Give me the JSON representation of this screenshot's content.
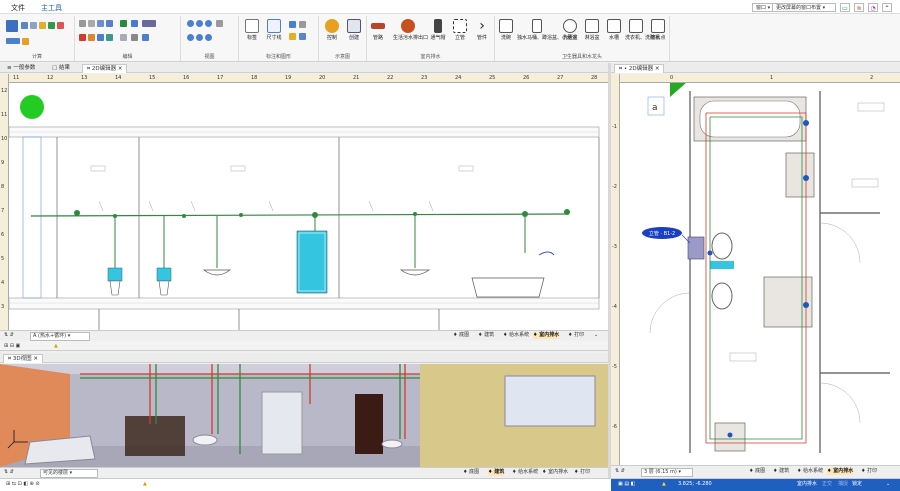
{
  "menu": {
    "file": "文件",
    "main_tools": "主工具"
  },
  "window_tools": {
    "window": "窗口 ▾",
    "layout": "更改屏幕的窗口布置 ▾"
  },
  "ribbon": {
    "groups": [
      "计算",
      "编辑",
      "视图",
      "标注和图形",
      "示意图",
      "室内排水",
      "卫生器具和水龙头"
    ],
    "items": {
      "mark": "标签",
      "dim": "尺寸线",
      "control": "控制",
      "create": "创建",
      "pipe": "管路",
      "outlet": "生活污水排出口",
      "vent_cap": "通气帽",
      "riser": "立管",
      "fitting": "管件",
      "sink": "洗碗",
      "urinal": "独水马桶、蹲浴盆、小便池",
      "washbasin": "洗脸盆",
      "shower_tray": "淋浴盆",
      "water_tank": "水槽",
      "washing_machine": "洗衣机、洗碗机",
      "floor_drain": "放水点"
    }
  },
  "left_tabs": [
    "一般参数",
    "结果",
    "2D编辑器"
  ],
  "right_tabs": [
    "2D编辑器"
  ],
  "view3d_tab": "3D视图",
  "ruler_top_left": [
    "11",
    "12",
    "13",
    "14",
    "15",
    "16",
    "17",
    "18",
    "19",
    "20",
    "21",
    "22",
    "23",
    "24",
    "25",
    "26",
    "27",
    "28"
  ],
  "ruler_left_left": [
    "12",
    "11",
    "10",
    "9",
    "8",
    "7",
    "6",
    "5",
    "4",
    "3"
  ],
  "ruler_top_right": [
    "0",
    "1",
    "2"
  ],
  "ruler_left_right": [
    "-1",
    "-2",
    "-3",
    "-4",
    "-5",
    "-6"
  ],
  "left_status": {
    "layer": "A (热水+循环)",
    "items": [
      "底图",
      "建筑",
      "给水系统",
      "室内排水",
      "打印"
    ]
  },
  "view3d_status": {
    "layer": "可见的楼层",
    "items": [
      "底图",
      "建筑",
      "给水系统",
      "室内排水",
      "打印"
    ]
  },
  "right_status": {
    "floor": "3 层 (6.15 m)",
    "items": [
      "底图",
      "建筑",
      "给水系统",
      "室内排水",
      "打印"
    ]
  },
  "plan": {
    "riser_label": "立管 · B1-2",
    "room_letter": "a"
  },
  "bottom": {
    "coords": "3.825; -6.280",
    "mode": "室内排水",
    "ortho": "正交",
    "osnap": "捕捉",
    "lock": "锁定"
  },
  "colors": {
    "accent": "#1d5fb0",
    "drain_green": "#2e8b3a",
    "hot_red": "#d23a2a",
    "plan_bg": "#ffffff",
    "ruler": "#f5efd9",
    "statusbar_bottom": "#1f5fbf"
  }
}
